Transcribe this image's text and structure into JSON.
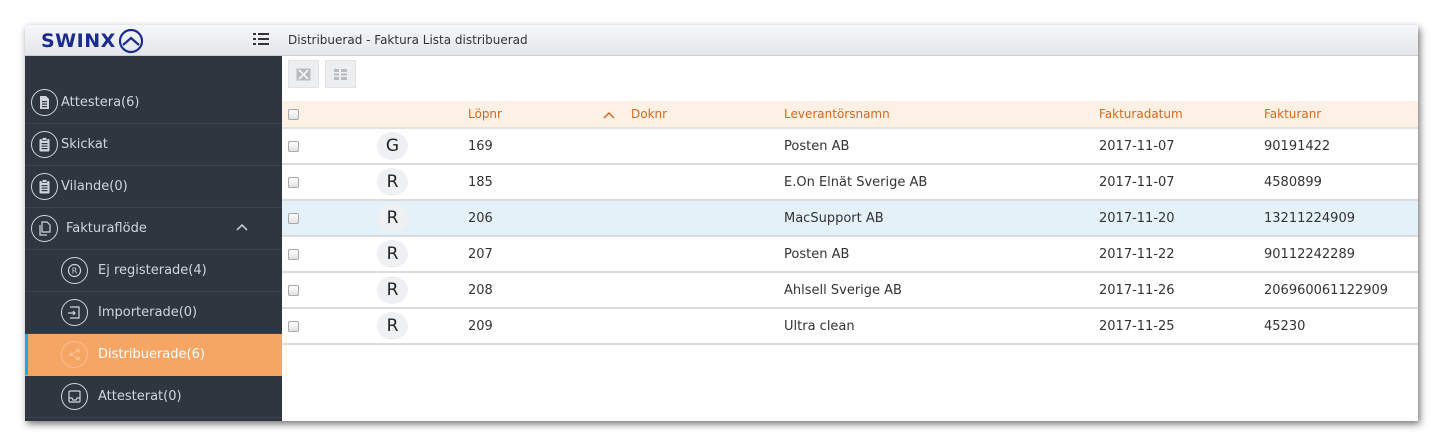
{
  "app": {
    "logo_text": "SWINX",
    "brand_color": "#1a2c8e"
  },
  "sidebar": {
    "items": [
      {
        "label": "Attestera(6)",
        "icon": "document-icon",
        "level": "top"
      },
      {
        "label": "Skickat",
        "icon": "clipboard-icon",
        "level": "top"
      },
      {
        "label": "Vilande(0)",
        "icon": "clipboard-icon",
        "level": "top"
      },
      {
        "label": "Fakturaflöde",
        "icon": "copy-document-icon",
        "level": "top",
        "expanded": true
      },
      {
        "label": "Ej registerade(4)",
        "icon": "registered-icon",
        "level": "sub"
      },
      {
        "label": "Importerade(0)",
        "icon": "import-icon",
        "level": "sub"
      },
      {
        "label": "Distribuerade(6)",
        "icon": "distribute-icon",
        "level": "sub",
        "active": true
      },
      {
        "label": "Attesterat(0)",
        "icon": "inbox-icon",
        "level": "sub"
      }
    ],
    "active_color": "#f5a664"
  },
  "header": {
    "title": "Distribuerad - Faktura Lista distribuerad"
  },
  "toolbar": {
    "buttons": [
      "close-icon",
      "split-icon"
    ]
  },
  "table": {
    "columns": {
      "lopnr": "Löpnr",
      "doknr": "Doknr",
      "leverantor": "Leverantörsnamn",
      "datum": "Fakturadatum",
      "fakturanr": "Fakturanr"
    },
    "sort": {
      "column": "Löpnr",
      "direction": "ascending"
    },
    "rows": [
      {
        "status": "G",
        "lopnr": "169",
        "doknr": "",
        "leverantor": "Posten AB",
        "datum": "2017-11-07",
        "fakturanr": "90191422"
      },
      {
        "status": "R",
        "lopnr": "185",
        "doknr": "",
        "leverantor": "E.On Elnät Sverige AB",
        "datum": "2017-11-07",
        "fakturanr": "4580899"
      },
      {
        "status": "R",
        "lopnr": "206",
        "doknr": "",
        "leverantor": "MacSupport AB",
        "datum": "2017-11-20",
        "fakturanr": "13211224909",
        "selected": true
      },
      {
        "status": "R",
        "lopnr": "207",
        "doknr": "",
        "leverantor": "Posten AB",
        "datum": "2017-11-22",
        "fakturanr": "90112242289"
      },
      {
        "status": "R",
        "lopnr": "208",
        "doknr": "",
        "leverantor": "Ahlsell Sverige AB",
        "datum": "2017-11-26",
        "fakturanr": "206960061122909"
      },
      {
        "status": "R",
        "lopnr": "209",
        "doknr": "",
        "leverantor": "Ultra clean",
        "datum": "2017-11-25",
        "fakturanr": "45230"
      }
    ],
    "header_color": "#d2691e",
    "selected_row_color": "#e4f1f8"
  }
}
